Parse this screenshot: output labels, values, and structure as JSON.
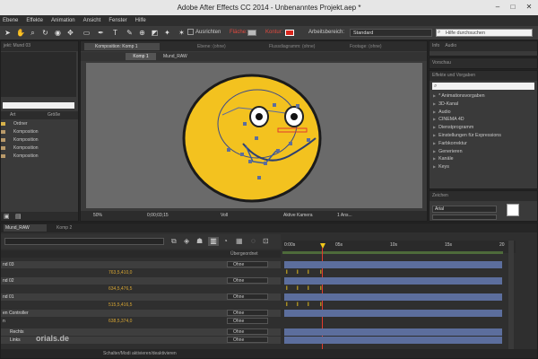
{
  "window": {
    "title": "Adobe After Effects CC 2014 - Unbenanntes Projekt.aep *",
    "min": "–",
    "max": "□",
    "close": "✕"
  },
  "menu": [
    "Ebene",
    "Effekte",
    "Animation",
    "Ansicht",
    "Fenster",
    "Hilfe"
  ],
  "toolbar": {
    "ausrichten": "Ausrichten",
    "flaeche": "Fläche:",
    "kontur": "Kontur:",
    "arbeitsbereich_label": "Arbeitsbereich:",
    "arbeitsbereich_value": "Standard",
    "search_placeholder": "Hilfe durchsuchen"
  },
  "project": {
    "tab": "jekt: Mund 03",
    "col_name": "Art",
    "col_size": "Größe",
    "items": [
      {
        "type": "Ordner",
        "icon": "folder"
      },
      {
        "type": "Komposition",
        "icon": "comp"
      },
      {
        "type": "Komposition",
        "icon": "comp"
      },
      {
        "type": "Komposition",
        "icon": "comp"
      },
      {
        "type": "Komposition",
        "icon": "comp"
      }
    ]
  },
  "composition": {
    "tab": "Komposition: Komp 1",
    "tab2": "Ebene: (ohne)",
    "tab3": "Flussdiagramm: (ohne)",
    "tab4": "Footage: (ohne)",
    "nav": [
      "Komp 1",
      "Mund_RAW"
    ],
    "footer": {
      "zoom": "50%",
      "timecode": "0;00;03;15",
      "quality": "Voll",
      "camera": "Aktive Kamera",
      "views": "1 Ans..."
    }
  },
  "right": {
    "tabs_top": [
      "Info",
      "Audio"
    ],
    "vorschau": "Vorschau",
    "effekte_tab": "Effekte und Vorgaben",
    "search_icon": "search",
    "effects": [
      "* Animationsvorgaben",
      "3D-Kanal",
      "Audio",
      "CINEMA 4D",
      "Dienstprogramm",
      "Einstellungen für Expressions",
      "Farbkorrektur",
      "Generieren",
      "Kanäle",
      "Keys"
    ],
    "zeichen_tab": "Zeichen",
    "font": "Arial"
  },
  "timeline": {
    "tabs": [
      "Mund_RAW",
      "Komp 2"
    ],
    "col_parent": "Übergeordnet",
    "ruler": [
      "0:00s",
      "05s",
      "10s",
      "15s",
      "20"
    ],
    "footer": "Schalter/Modi aktivieren/deaktivieren",
    "layers": [
      {
        "name": "nd 03",
        "value": "",
        "parent": "Ohne"
      },
      {
        "name": "",
        "value": "763,5,410,0",
        "parent": ""
      },
      {
        "name": "nd 02",
        "value": "",
        "parent": "Ohne"
      },
      {
        "name": "",
        "value": "634,5,476,5",
        "parent": ""
      },
      {
        "name": "nd 01",
        "value": "",
        "parent": "Ohne"
      },
      {
        "name": "",
        "value": "515,5,416,5",
        "parent": ""
      },
      {
        "name": "en Controller",
        "value": "",
        "parent": "Ohne"
      },
      {
        "name": "n",
        "value": "638,5,374,0",
        "parent": "Ohne"
      },
      {
        "name": "Rechts",
        "value": "",
        "parent": "Ohne"
      },
      {
        "name": "Links",
        "value": "",
        "parent": "Ohne"
      }
    ],
    "keyframes": {
      "rows": [
        1,
        3,
        5
      ],
      "positions": [
        1,
        2,
        3,
        4
      ]
    }
  },
  "watermark": "orials.de",
  "colors": {
    "face": "#f3c21f",
    "playhead": "#e23b2f",
    "layerbar": "#5c6e9d",
    "accent": "#f2c81a"
  }
}
